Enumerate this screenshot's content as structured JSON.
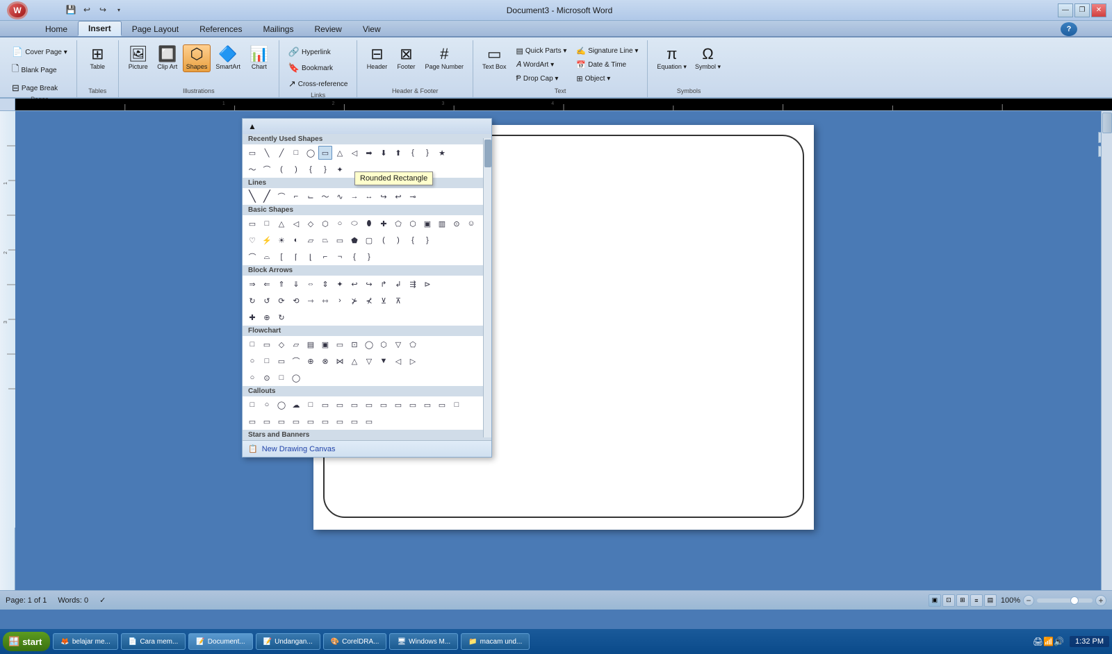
{
  "titleBar": {
    "title": "Document3 - Microsoft Word",
    "minBtn": "—",
    "maxBtn": "❐",
    "closeBtn": "✕"
  },
  "quickAccess": {
    "save": "💾",
    "undo": "↩",
    "redo": "↪",
    "customize": "▾"
  },
  "tabs": [
    {
      "id": "home",
      "label": "Home"
    },
    {
      "id": "insert",
      "label": "Insert",
      "active": true
    },
    {
      "id": "pagelayout",
      "label": "Page Layout"
    },
    {
      "id": "references",
      "label": "References"
    },
    {
      "id": "mailings",
      "label": "Mailings"
    },
    {
      "id": "review",
      "label": "Review"
    },
    {
      "id": "view",
      "label": "View"
    }
  ],
  "ribbon": {
    "groups": [
      {
        "id": "pages",
        "label": "Pages",
        "items": [
          "Cover Page",
          "Blank Page",
          "Page Break"
        ]
      },
      {
        "id": "tables",
        "label": "Tables",
        "items": [
          "Table"
        ]
      },
      {
        "id": "illustrations",
        "label": "Illustrations",
        "items": [
          "Picture",
          "Clip Art",
          "Shapes",
          "SmartArt",
          "Chart"
        ]
      },
      {
        "id": "links",
        "label": "Links",
        "items": [
          "Hyperlink",
          "Bookmark",
          "Cross-reference"
        ]
      },
      {
        "id": "headerfooter",
        "label": "Header & Footer",
        "items": [
          "Header",
          "Footer",
          "Page Number"
        ]
      },
      {
        "id": "text",
        "label": "Text",
        "items": [
          "Text Box",
          "Quick Parts",
          "WordArt",
          "Drop Cap",
          "Signature Line",
          "Date & Time",
          "Object"
        ]
      },
      {
        "id": "symbols",
        "label": "Symbols",
        "items": [
          "Equation",
          "Symbol"
        ]
      }
    ]
  },
  "shapesDropdown": {
    "title": "Recently Used Shapes",
    "sections": [
      {
        "id": "recently-used",
        "label": "Recently Used Shapes",
        "shapes": [
          "▭",
          "\\",
          "⟋",
          "▭",
          "◯",
          "▭",
          "△",
          "⟆",
          "⟇",
          "⟈",
          "⟉",
          "⟊",
          "⟋",
          "⟌",
          "⟍",
          "⟎",
          "⟏",
          "⟐",
          "⟑",
          "⟒",
          "⟓",
          "⟔",
          "★",
          "☆"
        ]
      },
      {
        "id": "lines",
        "label": "Lines",
        "shapes": [
          "╲",
          "╱",
          "⌒",
          "⌓",
          "⌔",
          "⌕",
          "⌖",
          "⌗",
          "⌘",
          "⌙",
          "⌚",
          "⌛"
        ]
      },
      {
        "id": "basic-shapes",
        "label": "Basic Shapes",
        "shapes": [
          "▭",
          "▢",
          "△",
          "▷",
          "◇",
          "⬡",
          "⭕",
          "△",
          "◯",
          "⬮",
          "✚",
          "⬡",
          "▣",
          "▤",
          "▥",
          "▦",
          "☺",
          "⊛",
          "⊕",
          "♡",
          "✶",
          "⚙",
          "⟡",
          "⊂",
          "⊃",
          "{}",
          "{}",
          "()",
          "{",
          "}",
          " ",
          " ",
          " "
        ]
      },
      {
        "id": "block-arrows",
        "label": "Block Arrows",
        "shapes": [
          "⇒",
          "⇐",
          "⇑",
          "⇓",
          "⇔",
          "⇕",
          "⇗",
          "↪",
          "↩",
          "⬐",
          "⬎",
          "⬏",
          "⬑",
          "↻",
          "↺",
          "⟳",
          "⟲",
          "↱",
          "↲",
          "⤴",
          "⤵",
          "⬆",
          "⬇",
          "⬅",
          "➡",
          "↖",
          "↗",
          "↘",
          "↙"
        ]
      },
      {
        "id": "flowchart",
        "label": "Flowchart",
        "shapes": [
          "▭",
          "◯",
          "⬡",
          "▱",
          "▭",
          "▭",
          "▭",
          "◯",
          "◯",
          "▭",
          "▽",
          "▭",
          "▭",
          "▭",
          "✕",
          "⊕",
          "⊿",
          "△",
          "▽",
          "▭",
          "◯",
          "▭",
          "▭",
          "◯"
        ]
      },
      {
        "id": "callouts",
        "label": "Callouts",
        "shapes": [
          "▭",
          "◯",
          "△",
          "⬡",
          "▱",
          "▭",
          "◯",
          "▭",
          "▭",
          "▭",
          "▭",
          "▭",
          "▭",
          "▭",
          "▭",
          "◯",
          "▭",
          "▭"
        ]
      },
      {
        "id": "stars-banners",
        "label": "Stars and Banners",
        "shapes": [
          "✦",
          "✧",
          "★",
          "✪",
          "✫",
          "✬",
          "✭",
          "✮",
          "✯",
          "✰"
        ]
      }
    ],
    "scrollVisible": true,
    "footer": "New Drawing Canvas"
  },
  "tooltip": {
    "text": "Rounded Rectangle"
  },
  "statusBar": {
    "page": "Page: 1 of 1",
    "words": "Words: 0",
    "spellCheck": "✓",
    "zoom": "100%"
  },
  "taskbar": {
    "startLabel": "start",
    "apps": [
      {
        "label": "belajar me...",
        "active": false
      },
      {
        "label": "Cara mem...",
        "active": false
      },
      {
        "label": "Document...",
        "active": true
      },
      {
        "label": "Undangan...",
        "active": false
      },
      {
        "label": "CorelDRA...",
        "active": false
      },
      {
        "label": "Windows M...",
        "active": false
      },
      {
        "label": "macam und...",
        "active": false
      }
    ],
    "time": "1:32 PM"
  }
}
